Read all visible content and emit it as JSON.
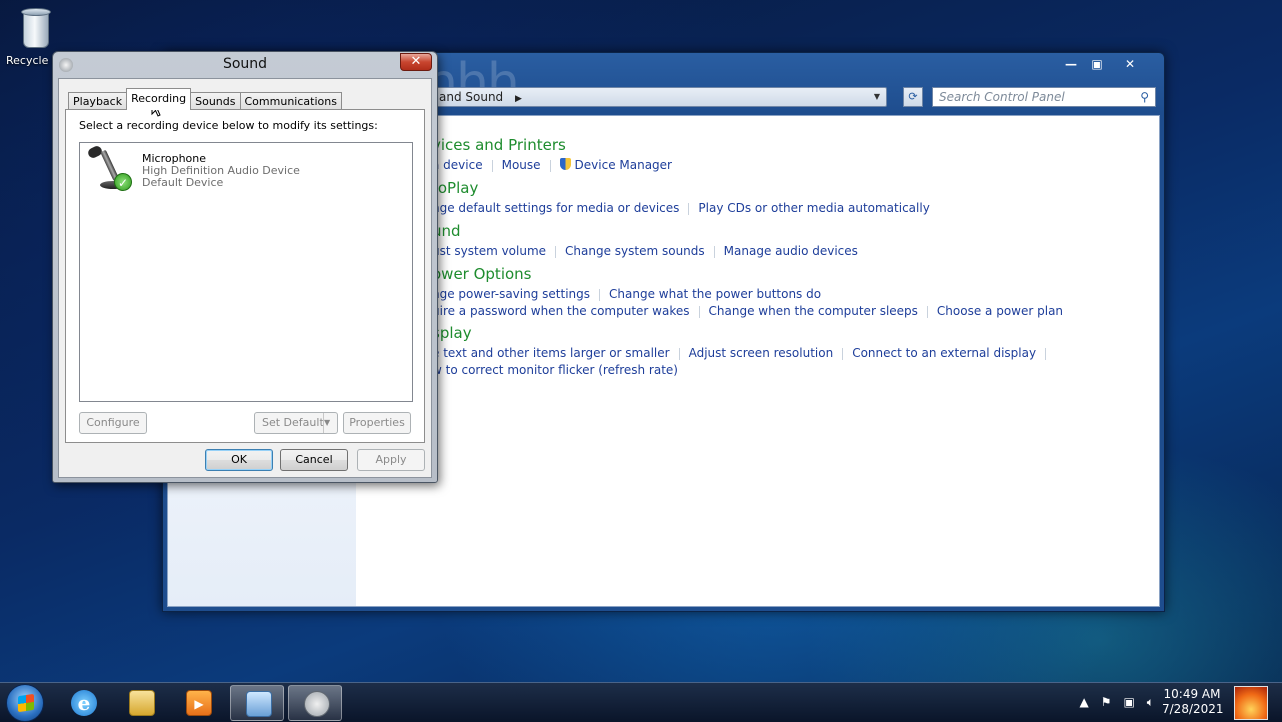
{
  "desktop": {
    "recycle_bin_label": "Recycle B",
    "watermark": "hhh..."
  },
  "control_panel": {
    "breadcrumb": "and Sound",
    "search_placeholder": "Search Control Panel",
    "sections": [
      {
        "heading": "vices and Printers",
        "rows": [
          [
            "a device",
            "Mouse",
            "Device Manager"
          ]
        ]
      },
      {
        "heading": "toPlay",
        "rows": [
          [
            "nge default settings for media or devices",
            "Play CDs or other media automatically"
          ]
        ]
      },
      {
        "heading": "und",
        "rows": [
          [
            "ust system volume",
            "Change system sounds",
            "Manage audio devices"
          ]
        ]
      },
      {
        "heading": "ower Options",
        "rows": [
          [
            "nge power-saving settings",
            "Change what the power buttons do"
          ],
          [
            "uire a password when the computer wakes",
            "Change when the computer sleeps",
            "Choose a power plan"
          ]
        ]
      },
      {
        "heading": "splay",
        "rows": [
          [
            "e text and other items larger or smaller",
            "Adjust screen resolution",
            "Connect to an external display"
          ],
          [
            "w to correct monitor flicker (refresh rate)"
          ]
        ]
      }
    ]
  },
  "dialog": {
    "title": "Sound",
    "tabs": [
      "Playback",
      "Recording",
      "Sounds",
      "Communications"
    ],
    "active_tab": "Recording",
    "instruction": "Select a recording device below to modify its settings:",
    "device": {
      "name": "Microphone",
      "description": "High Definition Audio Device",
      "status": "Default Device"
    },
    "buttons": {
      "configure": "Configure",
      "set_default": "Set Default",
      "properties": "Properties",
      "ok": "OK",
      "cancel": "Cancel",
      "apply": "Apply"
    }
  },
  "taskbar": {
    "time": "10:49 AM",
    "date": "7/28/2021"
  }
}
